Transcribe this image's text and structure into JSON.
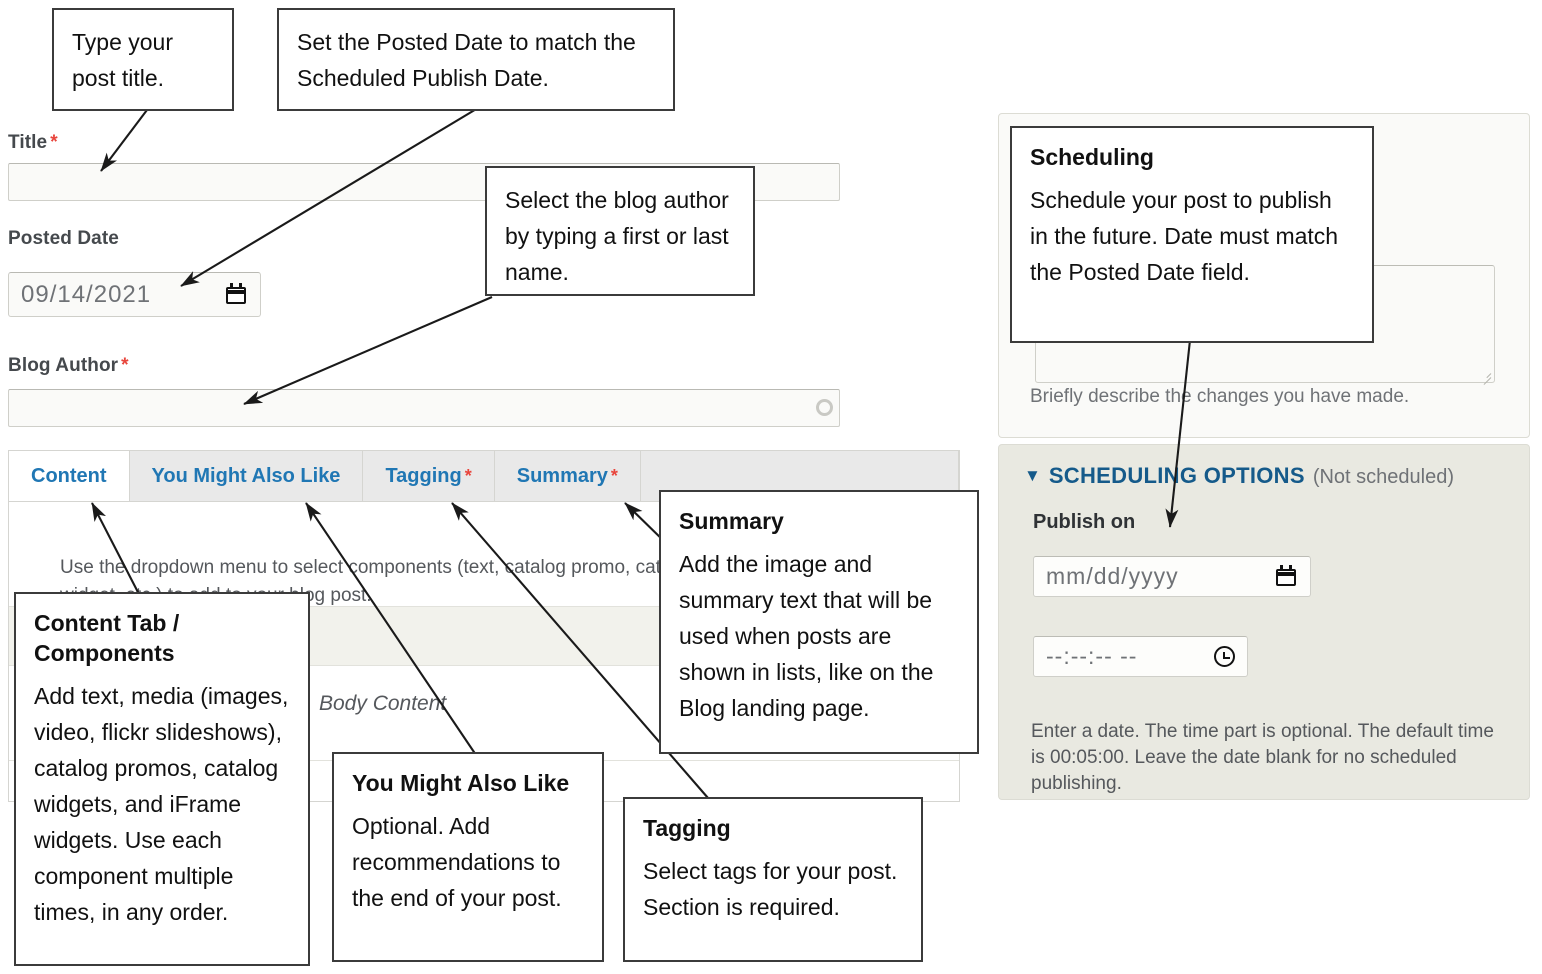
{
  "form": {
    "title_label": "Title",
    "title_required": "*",
    "title_value": "",
    "posted_date_label": "Posted Date",
    "posted_date_value": "09/14/2021",
    "blog_author_label": "Blog Author",
    "blog_author_required": "*",
    "blog_author_value": "",
    "tabs": [
      {
        "label": "Content",
        "required": "",
        "active": true
      },
      {
        "label": "You Might Also Like",
        "required": "",
        "active": false
      },
      {
        "label": "Tagging",
        "required": "*",
        "active": false
      },
      {
        "label": "Summary",
        "required": "*",
        "active": false
      }
    ],
    "helper_text": "Use the dropdown menu to select components (text, catalog promo, catalog widget, etc.) to add to your blog post.",
    "body_content_label": "Body Content"
  },
  "right_panel": {
    "revision_hint": "Briefly describe the changes you have made.",
    "scheduling_caret": "▼",
    "scheduling_title": "SCHEDULING OPTIONS",
    "scheduling_status": "(Not scheduled)",
    "publish_on_label": "Publish on",
    "publish_date_placeholder": "mm/dd/yyyy",
    "publish_time_placeholder": "--:--:-- --",
    "scheduling_note": "Enter a date. The time part is optional. The default time is 00:05:00. Leave the date blank for no scheduled publishing."
  },
  "callouts": {
    "title": {
      "body": "Type your post title."
    },
    "posted_date": {
      "body": "Set the Posted Date to match the Scheduled Publish Date."
    },
    "blog_author": {
      "body": "Select the blog author by typing a first or last name."
    },
    "content_tab": {
      "title": "Content Tab / Components",
      "body": "Add text, media (images, video, flickr slideshows), catalog promos, catalog widgets, and iFrame widgets. Use each component multiple times, in any order."
    },
    "you_might_also_like": {
      "title": "You Might Also Like",
      "body": "Optional. Add recommendations to the end of your post."
    },
    "tagging": {
      "title": "Tagging",
      "body": "Select tags for your post. Section is required."
    },
    "summary": {
      "title": "Summary",
      "body": "Add the image and summary text that will be used when posts are shown in lists, like on the Blog landing page."
    },
    "scheduling": {
      "title": "Scheduling",
      "body": "Schedule your post to publish in the future. Date must match the Posted Date field."
    }
  },
  "colors": {
    "tab_blue": "#2077b4",
    "heading_blue": "#155a8a",
    "required_red": "#e8453c",
    "callout_border": "#3b3b3b",
    "panel_bg": "#fafaf8",
    "sched_bg": "#e9e9e1"
  }
}
